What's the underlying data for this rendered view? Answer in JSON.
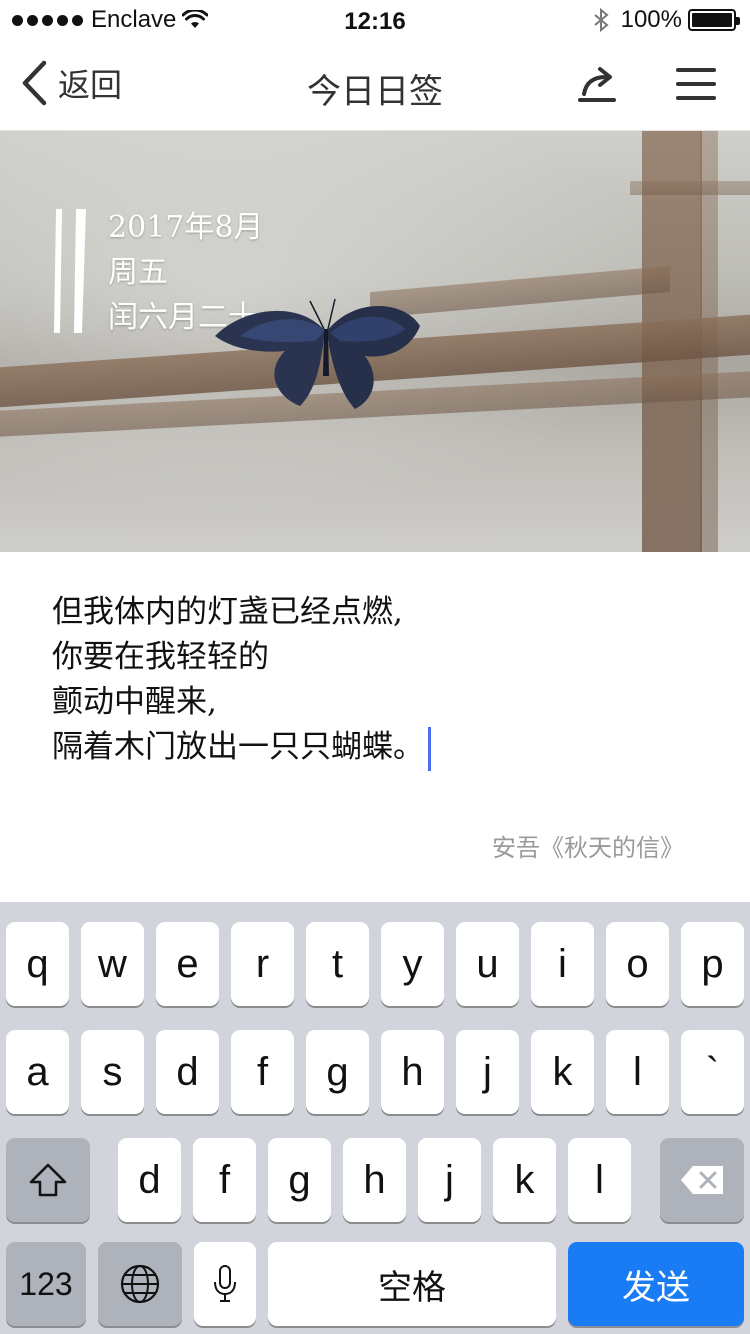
{
  "status_bar": {
    "carrier": "Enclave",
    "time": "12:16",
    "battery": "100%",
    "icons": [
      "signal-dots-icon",
      "wifi-icon",
      "bluetooth-icon",
      "battery-icon"
    ]
  },
  "nav": {
    "back_label": "返回",
    "title": "今日日签",
    "icons": [
      "chevron-left-icon",
      "share-icon",
      "menu-icon"
    ]
  },
  "hero": {
    "date_line1": "2017年8月",
    "date_line2": "周五",
    "date_line3": "闰六月二十"
  },
  "poem": {
    "lines": [
      "但我体内的灯盏已经点燃,",
      "你要在我轻轻的",
      "颤动中醒来,",
      "隔着木门放出一只只蝴蝶。"
    ],
    "source": "安吾《秋天的信》"
  },
  "keyboard": {
    "row1": [
      "q",
      "w",
      "e",
      "r",
      "t",
      "y",
      "u",
      "i",
      "o",
      "p"
    ],
    "row2": [
      "a",
      "s",
      "d",
      "f",
      "g",
      "h",
      "j",
      "k",
      "l",
      "`"
    ],
    "row3": [
      "d",
      "f",
      "g",
      "h",
      "j",
      "k",
      "l"
    ],
    "numbers_key": "123",
    "space_key": "空格",
    "send_key": "发送",
    "icons": [
      "shift-icon",
      "delete-icon",
      "globe-icon",
      "microphone-icon"
    ]
  },
  "colors": {
    "accent": "#1a7cf5",
    "cursor": "#4a6cf7",
    "keyboard_bg": "#d1d4da"
  }
}
